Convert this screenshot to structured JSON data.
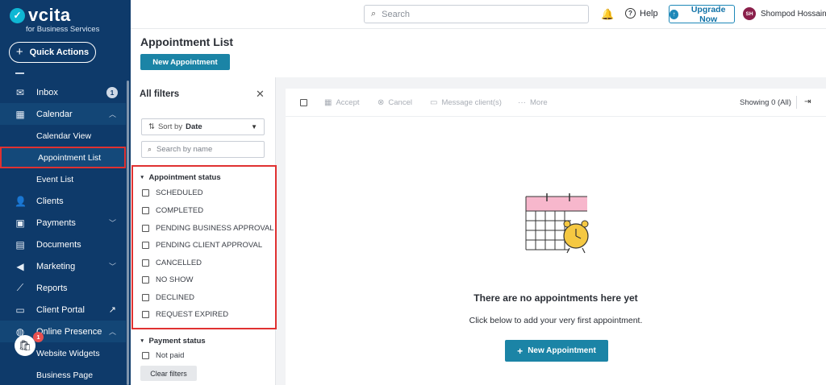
{
  "brand": {
    "name": "vcita",
    "tagline": "for Business Services",
    "accent": "#0fb7d4",
    "sidebar_color": "#0e3a6a"
  },
  "sidebar": {
    "quick_actions": "Quick Actions",
    "inbox": {
      "label": "Inbox",
      "count": "1"
    },
    "calendar": {
      "label": "Calendar"
    },
    "calendar_sub": [
      "Calendar View",
      "Appointment List",
      "Event List"
    ],
    "clients": "Clients",
    "payments": "Payments",
    "documents": "Documents",
    "marketing": "Marketing",
    "reports": "Reports",
    "client_portal": "Client Portal",
    "online_presence": "Online Presence",
    "online_sub": [
      "Website Widgets",
      "Business Page"
    ],
    "shop_badge": "1"
  },
  "topbar": {
    "search_placeholder": "Search",
    "help": "Help",
    "upgrade": "Upgrade Now",
    "user_initials": "SH",
    "user_name": "Shompod Hossain"
  },
  "page": {
    "title": "Appointment List",
    "new_appointment": "New Appointment"
  },
  "filters": {
    "title": "All filters",
    "sort_prefix": "Sort by",
    "sort_value": "Date",
    "search_placeholder": "Search by name",
    "appointment_status": {
      "label": "Appointment status",
      "options": [
        "SCHEDULED",
        "COMPLETED",
        "PENDING BUSINESS APPROVAL",
        "PENDING CLIENT APPROVAL",
        "CANCELLED",
        "NO SHOW",
        "DECLINED",
        "REQUEST EXPIRED"
      ]
    },
    "payment_status": {
      "label": "Payment status",
      "options": [
        "Not paid"
      ]
    },
    "clear": "Clear filters"
  },
  "toolbar": {
    "accept": "Accept",
    "cancel": "Cancel",
    "message": "Message client(s)",
    "more": "More",
    "showing": "Showing 0 (All)"
  },
  "empty": {
    "title": "There are no appointments here yet",
    "subtitle": "Click below to add your very first appointment.",
    "button": "New Appointment"
  }
}
